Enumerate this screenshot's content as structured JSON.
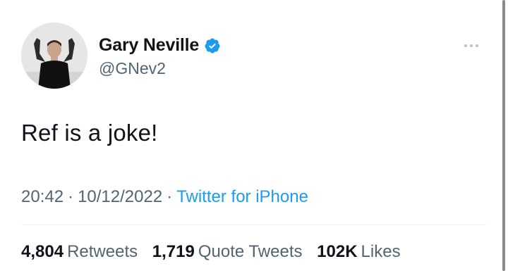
{
  "author": {
    "display_name": "Gary Neville",
    "handle": "@GNev2",
    "verified": true,
    "avatar_icon": "profile-photo-avatar"
  },
  "tweet": {
    "text": "Ref is a joke!",
    "time": "20:42",
    "date": "10/12/2022",
    "source": "Twitter for iPhone",
    "separator": "·"
  },
  "stats": [
    {
      "value": "4,804",
      "label": "Retweets"
    },
    {
      "value": "1,719",
      "label": "Quote Tweets"
    },
    {
      "value": "102K",
      "label": "Likes"
    }
  ],
  "colors": {
    "accent": "#1d9bf0",
    "text": "#0f1419",
    "secondary": "#536471"
  }
}
